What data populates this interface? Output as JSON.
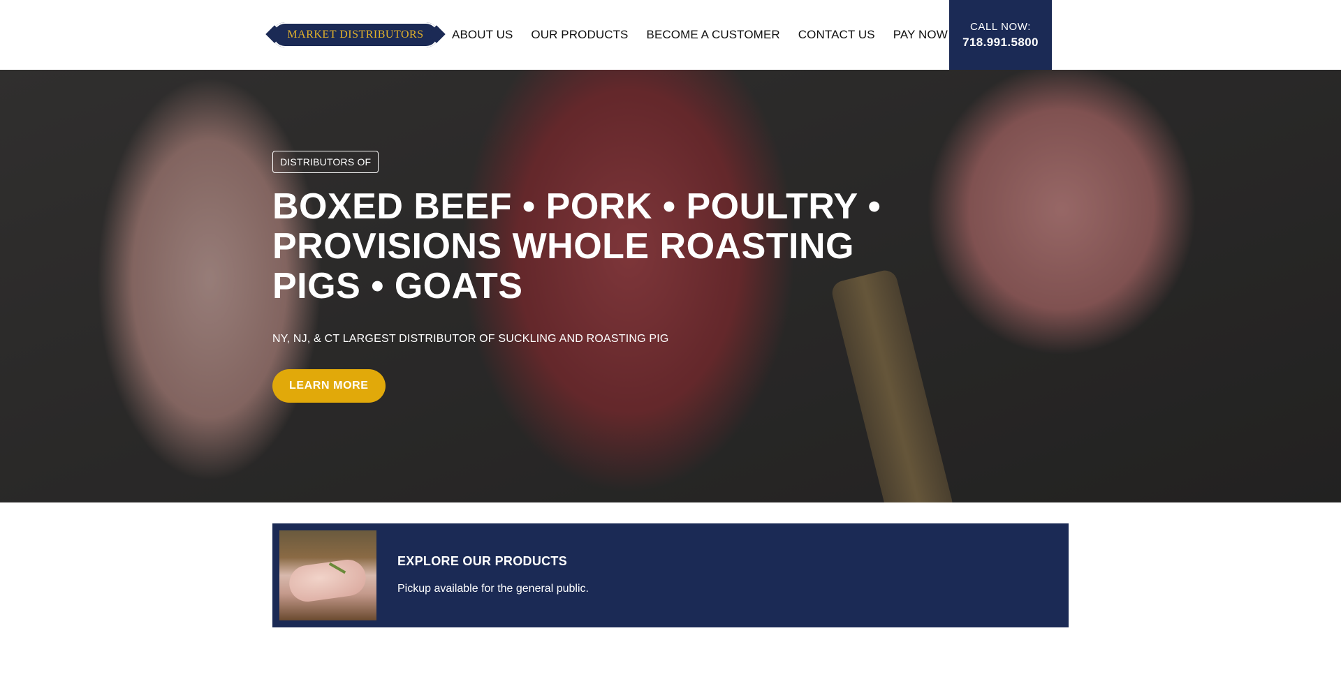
{
  "header": {
    "logo_text": "MARKET DISTRIBUTORS",
    "nav": [
      "ABOUT US",
      "OUR PRODUCTS",
      "BECOME A CUSTOMER",
      "CONTACT US",
      "PAY NOW"
    ],
    "call_label": "CALL NOW:",
    "call_number": "718.991.5800"
  },
  "hero": {
    "tag": "DISTRIBUTORS OF",
    "headline": "BOXED BEEF • PORK • POULTRY • PROVISIONS WHOLE ROASTING PIGS • GOATS",
    "subheadline": "NY, NJ, & CT LARGEST DISTRIBUTOR OF SUCKLING AND ROASTING PIG",
    "cta": "LEARN MORE"
  },
  "products_banner": {
    "title": "EXPLORE OUR PRODUCTS",
    "description": "Pickup available for the general public."
  },
  "colors": {
    "navy": "#1b2a55",
    "gold": "#e1a90a"
  }
}
